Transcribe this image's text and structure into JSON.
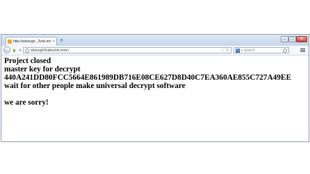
{
  "browser": {
    "tab": {
      "title": "http://sduecgh...2vhk.onion/"
    },
    "new_tab_label": "+",
    "window_controls": {
      "minimize": "–",
      "maximize": "□",
      "close": "✕"
    },
    "url": "sduecgh3nalkzvhk.onion",
    "search": {
      "engine": "G",
      "placeholder": "Search"
    },
    "icons": {
      "favicon": "orange-page-icon",
      "back": "back-arrow-icon",
      "forward": "forward-arrow-icon",
      "star": "star-icon",
      "reload": "reload-icon",
      "search": "magnifier-icon",
      "menu": "hamburger-menu-icon"
    }
  },
  "page": {
    "lines": [
      "Project closed",
      "master key for decrypt",
      "440A241DD80FCC5664E861989DB716E08CE627D8D40C7EA360AE855C727A49EE",
      "wait for other people make universal decrypt software",
      "",
      "we are sorry!"
    ]
  }
}
